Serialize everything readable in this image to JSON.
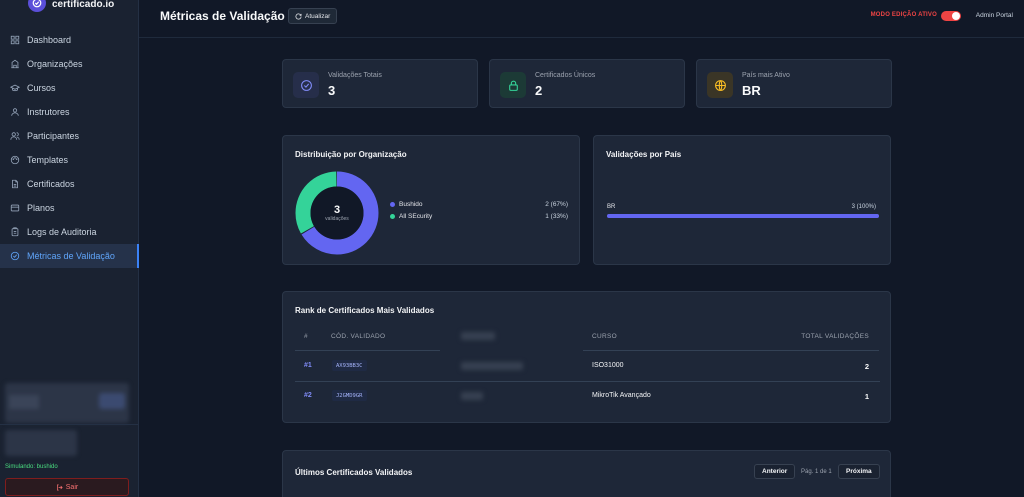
{
  "brand": {
    "name": "certificado.io"
  },
  "sidebar": {
    "items": [
      {
        "label": "Dashboard",
        "icon": "grid-icon"
      },
      {
        "label": "Organizações",
        "icon": "building-icon"
      },
      {
        "label": "Cursos",
        "icon": "book-icon"
      },
      {
        "label": "Instrutores",
        "icon": "user-icon"
      },
      {
        "label": "Participantes",
        "icon": "users-icon"
      },
      {
        "label": "Templates",
        "icon": "palette-icon"
      },
      {
        "label": "Certificados",
        "icon": "file-icon"
      },
      {
        "label": "Planos",
        "icon": "card-icon"
      },
      {
        "label": "Logs de Auditoria",
        "icon": "clipboard-icon"
      },
      {
        "label": "Métricas de Validação",
        "icon": "check-circle-icon",
        "active": true
      }
    ],
    "simulating": "Simulando: bushido",
    "logout_label": "Sair"
  },
  "header": {
    "title": "Métricas de Validação",
    "refresh_label": "Atualizar",
    "edit_mode_label": "MODO EDIÇÃO ATIVO",
    "edit_mode_on": true,
    "user_label": "Admin Portal"
  },
  "stats": [
    {
      "label": "Validações Totais",
      "value": "3",
      "icon": "check-circle-icon",
      "color": "#818cf8"
    },
    {
      "label": "Certificados Únicos",
      "value": "2",
      "icon": "lock-icon",
      "color": "#34d399"
    },
    {
      "label": "País mais Ativo",
      "value": "BR",
      "icon": "globe-icon",
      "color": "#fbbf24"
    }
  ],
  "org_distribution": {
    "title": "Distribuição por Organização",
    "center_value": "3",
    "center_label": "validações",
    "entries": [
      {
        "name": "Bushido",
        "count": 2,
        "display": "2 (67%)",
        "color": "#6366f1"
      },
      {
        "name": "All SEcurity",
        "count": 1,
        "display": "1 (33%)",
        "color": "#34d399"
      }
    ]
  },
  "country_validations": {
    "title": "Validações por País",
    "entries": [
      {
        "country": "BR",
        "display": "3 (100%)",
        "fraction": 1.0
      }
    ]
  },
  "rank": {
    "title": "Rank de Certificados Mais Validados",
    "headers": {
      "num": "#",
      "code": "CÓD. VALIDADO",
      "course": "CURSO",
      "total": "TOTAL VALIDAÇÕES"
    },
    "rows": [
      {
        "rank": "#1",
        "code": "AX93BB3C",
        "course": "ISO31000",
        "total": "2"
      },
      {
        "rank": "#2",
        "code": "J2GMD9GR",
        "course": "MikroTik Avançado",
        "total": "1"
      }
    ]
  },
  "latest": {
    "title": "Últimos Certificados Validados",
    "prev_label": "Anterior",
    "page_label": "Pág. 1 de 1",
    "next_label": "Próxima"
  }
}
